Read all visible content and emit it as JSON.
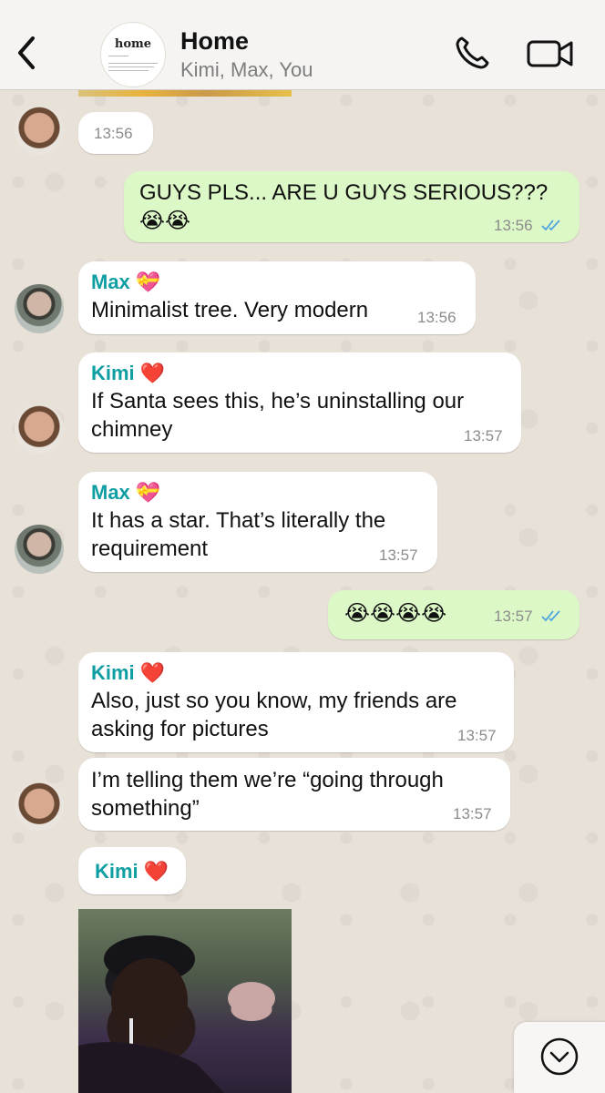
{
  "header": {
    "title": "Home",
    "participants": "Kimi, Max, You",
    "group_logo_word": "home"
  },
  "messages": [
    {
      "id": "m1",
      "direction": "in",
      "sender": "Kimi",
      "time": "13:56",
      "text": ""
    },
    {
      "id": "m2",
      "direction": "out",
      "text": "GUYS PLS... ARE U GUYS SERIOUS???\n😭😭",
      "time": "13:56",
      "status": "read"
    },
    {
      "id": "m3",
      "direction": "in",
      "sender": "Max",
      "sender_emoji": "💝",
      "text": "Minimalist tree. Very modern",
      "time": "13:56"
    },
    {
      "id": "m4",
      "direction": "in",
      "sender": "Kimi",
      "sender_emoji": "❤️",
      "text": "If Santa sees this, he’s uninstalling our\nchimney",
      "time": "13:57"
    },
    {
      "id": "m5",
      "direction": "in",
      "sender": "Max",
      "sender_emoji": "💝",
      "text": "It has a star. That’s literally the\nrequirement",
      "time": "13:57"
    },
    {
      "id": "m6",
      "direction": "out",
      "text": "😭😭😭😭",
      "time": "13:57",
      "status": "read"
    },
    {
      "id": "m7",
      "direction": "in",
      "sender": "Kimi",
      "sender_emoji": "❤️",
      "text": "Also, just so you know, my friends are\nasking for pictures",
      "time": "13:57"
    },
    {
      "id": "m8",
      "direction": "in",
      "sender": "Kimi",
      "text": "I’m telling them we’re “going through\nsomething”",
      "time": "13:57"
    },
    {
      "id": "m9",
      "direction": "in",
      "sender": "Kimi",
      "sender_emoji": "❤️",
      "type": "photo"
    }
  ],
  "colors": {
    "outgoing_bubble": "#dcf8c6",
    "incoming_bubble": "#ffffff",
    "sender_name": "#0f9fa3",
    "read_ticks": "#4fa3e0",
    "chat_background": "#e8e1d8"
  },
  "icons": {
    "back": "chevron-left-icon",
    "call": "phone-icon",
    "video": "video-camera-icon",
    "scroll": "chevron-down-circle-icon"
  }
}
